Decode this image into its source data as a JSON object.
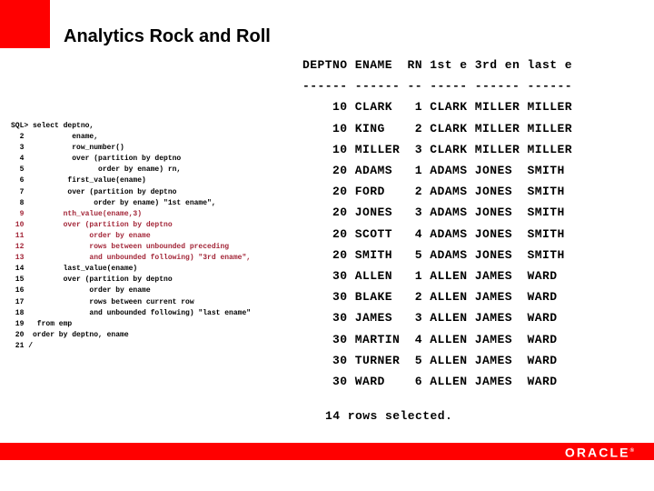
{
  "branding": {
    "corner_square_color": "#ff0000",
    "footer_bar_color": "#ff0000",
    "logo_text": "ORACLE",
    "logo_mark": "®"
  },
  "slide": {
    "title": "Analytics Rock and Roll"
  },
  "sql_console": {
    "prompt": "SQL>",
    "code_red_color": "#a32638",
    "lines": [
      {
        "num": "SQL>",
        "text": "select deptno,",
        "color": "black"
      },
      {
        "num": "2",
        "text": "            ename,",
        "color": "black"
      },
      {
        "num": "3",
        "text": "            row_number()",
        "color": "black"
      },
      {
        "num": "4",
        "text": "            over (partition by deptno",
        "color": "black"
      },
      {
        "num": "5",
        "text": "                  order by ename) rn,",
        "color": "black"
      },
      {
        "num": "6",
        "text": "           first_value(ename)",
        "color": "black"
      },
      {
        "num": "7",
        "text": "           over (partition by deptno",
        "color": "black"
      },
      {
        "num": "8",
        "text": "                 order by ename) \"1st ename\",",
        "color": "black"
      },
      {
        "num": "9",
        "text": "          nth_value(ename,3)",
        "color": "red"
      },
      {
        "num": "10",
        "text": "          over (partition by deptno",
        "color": "red"
      },
      {
        "num": "11",
        "text": "                order by ename",
        "color": "red"
      },
      {
        "num": "12",
        "text": "                rows between unbounded preceding",
        "color": "red"
      },
      {
        "num": "13",
        "text": "                and unbounded following) \"3rd ename\",",
        "color": "red"
      },
      {
        "num": "14",
        "text": "          last_value(ename)",
        "color": "black"
      },
      {
        "num": "15",
        "text": "          over (partition by deptno",
        "color": "black"
      },
      {
        "num": "16",
        "text": "                order by ename",
        "color": "black"
      },
      {
        "num": "17",
        "text": "                rows between current row",
        "color": "black"
      },
      {
        "num": "18",
        "text": "                and unbounded following) \"last ename\"",
        "color": "black"
      },
      {
        "num": "19",
        "text": "    from emp",
        "color": "black"
      },
      {
        "num": "20",
        "text": "  order by deptno, ename",
        "color": "black"
      },
      {
        "num": "21",
        "text": " /",
        "color": "black"
      }
    ],
    "code_text_black_1": "SQL> select deptno,\n  2           ename,\n  3           row_number()\n  4           over (partition by deptno\n  5                 order by ename) rn,\n  6          first_value(ename)\n  7          over (partition by deptno\n  8                order by ename) \"1st ename\",",
    "code_text_red": "  9         nth_value(ename,3)\n 10         over (partition by deptno\n 11               order by ename\n 12               rows between unbounded preceding\n 13               and unbounded following) \"3rd ename\",",
    "code_text_black_2": " 14         last_value(ename)\n 15         over (partition by deptno\n 16               order by ename\n 17               rows between current row\n 18               and unbounded following) \"last ename\"\n 19   from emp\n 20  order by deptno, ename\n 21 /"
  },
  "result_table": {
    "header": "DEPTNO ENAME  RN 1st e 3rd en last e",
    "separator": "------ ------ -- ----- ------ ------",
    "columns": [
      "DEPTNO",
      "ENAME",
      "RN",
      "1st e",
      "3rd en",
      "last e"
    ],
    "column_rules": [
      "------",
      "------",
      "--",
      "-----",
      "------",
      "------"
    ],
    "rows": [
      {
        "deptno": "10",
        "ename": "CLARK",
        "rn": "1",
        "first": "CLARK",
        "third": "MILLER",
        "last": "MILLER"
      },
      {
        "deptno": "10",
        "ename": "KING",
        "rn": "2",
        "first": "CLARK",
        "third": "MILLER",
        "last": "MILLER"
      },
      {
        "deptno": "10",
        "ename": "MILLER",
        "rn": "3",
        "first": "CLARK",
        "third": "MILLER",
        "last": "MILLER"
      },
      {
        "deptno": "20",
        "ename": "ADAMS",
        "rn": "1",
        "first": "ADAMS",
        "third": "JONES",
        "last": "SMITH"
      },
      {
        "deptno": "20",
        "ename": "FORD",
        "rn": "2",
        "first": "ADAMS",
        "third": "JONES",
        "last": "SMITH"
      },
      {
        "deptno": "20",
        "ename": "JONES",
        "rn": "3",
        "first": "ADAMS",
        "third": "JONES",
        "last": "SMITH"
      },
      {
        "deptno": "20",
        "ename": "SCOTT",
        "rn": "4",
        "first": "ADAMS",
        "third": "JONES",
        "last": "SMITH"
      },
      {
        "deptno": "20",
        "ename": "SMITH",
        "rn": "5",
        "first": "ADAMS",
        "third": "JONES",
        "last": "SMITH"
      },
      {
        "deptno": "30",
        "ename": "ALLEN",
        "rn": "1",
        "first": "ALLEN",
        "third": "JAMES",
        "last": "WARD"
      },
      {
        "deptno": "30",
        "ename": "BLAKE",
        "rn": "2",
        "first": "ALLEN",
        "third": "JAMES",
        "last": "WARD"
      },
      {
        "deptno": "30",
        "ename": "JAMES",
        "rn": "3",
        "first": "ALLEN",
        "third": "JAMES",
        "last": "WARD"
      },
      {
        "deptno": "30",
        "ename": "MARTIN",
        "rn": "4",
        "first": "ALLEN",
        "third": "JAMES",
        "last": "WARD"
      },
      {
        "deptno": "30",
        "ename": "TURNER",
        "rn": "5",
        "first": "ALLEN",
        "third": "JAMES",
        "last": "WARD"
      },
      {
        "deptno": "30",
        "ename": "WARD",
        "rn": "6",
        "first": "ALLEN",
        "third": "JAMES",
        "last": "WARD"
      }
    ],
    "output_text": "DEPTNO ENAME  RN 1st e 3rd en last e\n------ ------ -- ----- ------ ------\n    10 CLARK   1 CLARK MILLER MILLER\n    10 KING    2 CLARK MILLER MILLER\n    10 MILLER  3 CLARK MILLER MILLER\n    20 ADAMS   1 ADAMS JONES  SMITH\n    20 FORD    2 ADAMS JONES  SMITH\n    20 JONES   3 ADAMS JONES  SMITH\n    20 SCOTT   4 ADAMS JONES  SMITH\n    20 SMITH   5 ADAMS JONES  SMITH\n    30 ALLEN   1 ALLEN JAMES  WARD\n    30 BLAKE   2 ALLEN JAMES  WARD\n    30 JAMES   3 ALLEN JAMES  WARD\n    30 MARTIN  4 ALLEN JAMES  WARD\n    30 TURNER  5 ALLEN JAMES  WARD\n    30 WARD    6 ALLEN JAMES  WARD",
    "footer": "14 rows selected.",
    "row_count": "14"
  }
}
